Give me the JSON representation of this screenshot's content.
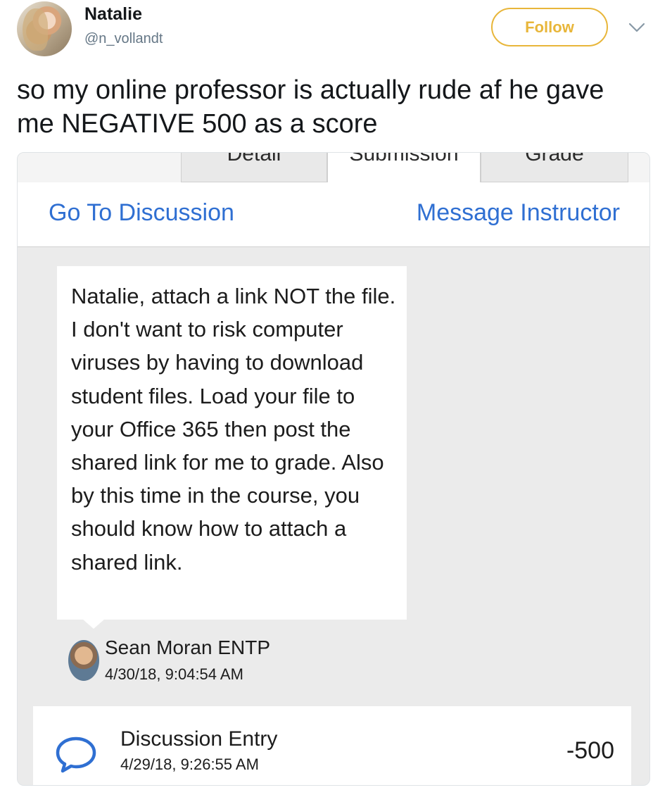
{
  "tweet": {
    "author_name": "Natalie",
    "author_handle": "@n_vollandt",
    "follow_label": "Follow",
    "text": "so my online professor is actually rude af he gave me NEGATIVE 500 as a score"
  },
  "screenshot": {
    "tabs": [
      {
        "label": "Detail"
      },
      {
        "label": "Submission"
      },
      {
        "label": "Grade"
      }
    ],
    "actions": {
      "go_to_discussion": "Go To Discussion",
      "message_instructor": "Message Instructor"
    },
    "comment": {
      "text": "Natalie, attach a link NOT the file. I don't want to risk computer viruses by having to download student files. Load your file to your Office 365 then post the shared link for me to grade. Also by this time in the course, you should know how to attach a shared link.",
      "author": "Sean Moran ENTP",
      "timestamp": "4/30/18, 9:04:54 AM"
    },
    "entry": {
      "icon": "speech-bubble-icon",
      "title": "Discussion Entry",
      "timestamp": "4/29/18, 9:26:55 AM",
      "score": "-500"
    }
  },
  "colors": {
    "follow_accent": "#e8b63a",
    "link_blue": "#2f6fd2",
    "panel_gray": "#ebebeb"
  }
}
